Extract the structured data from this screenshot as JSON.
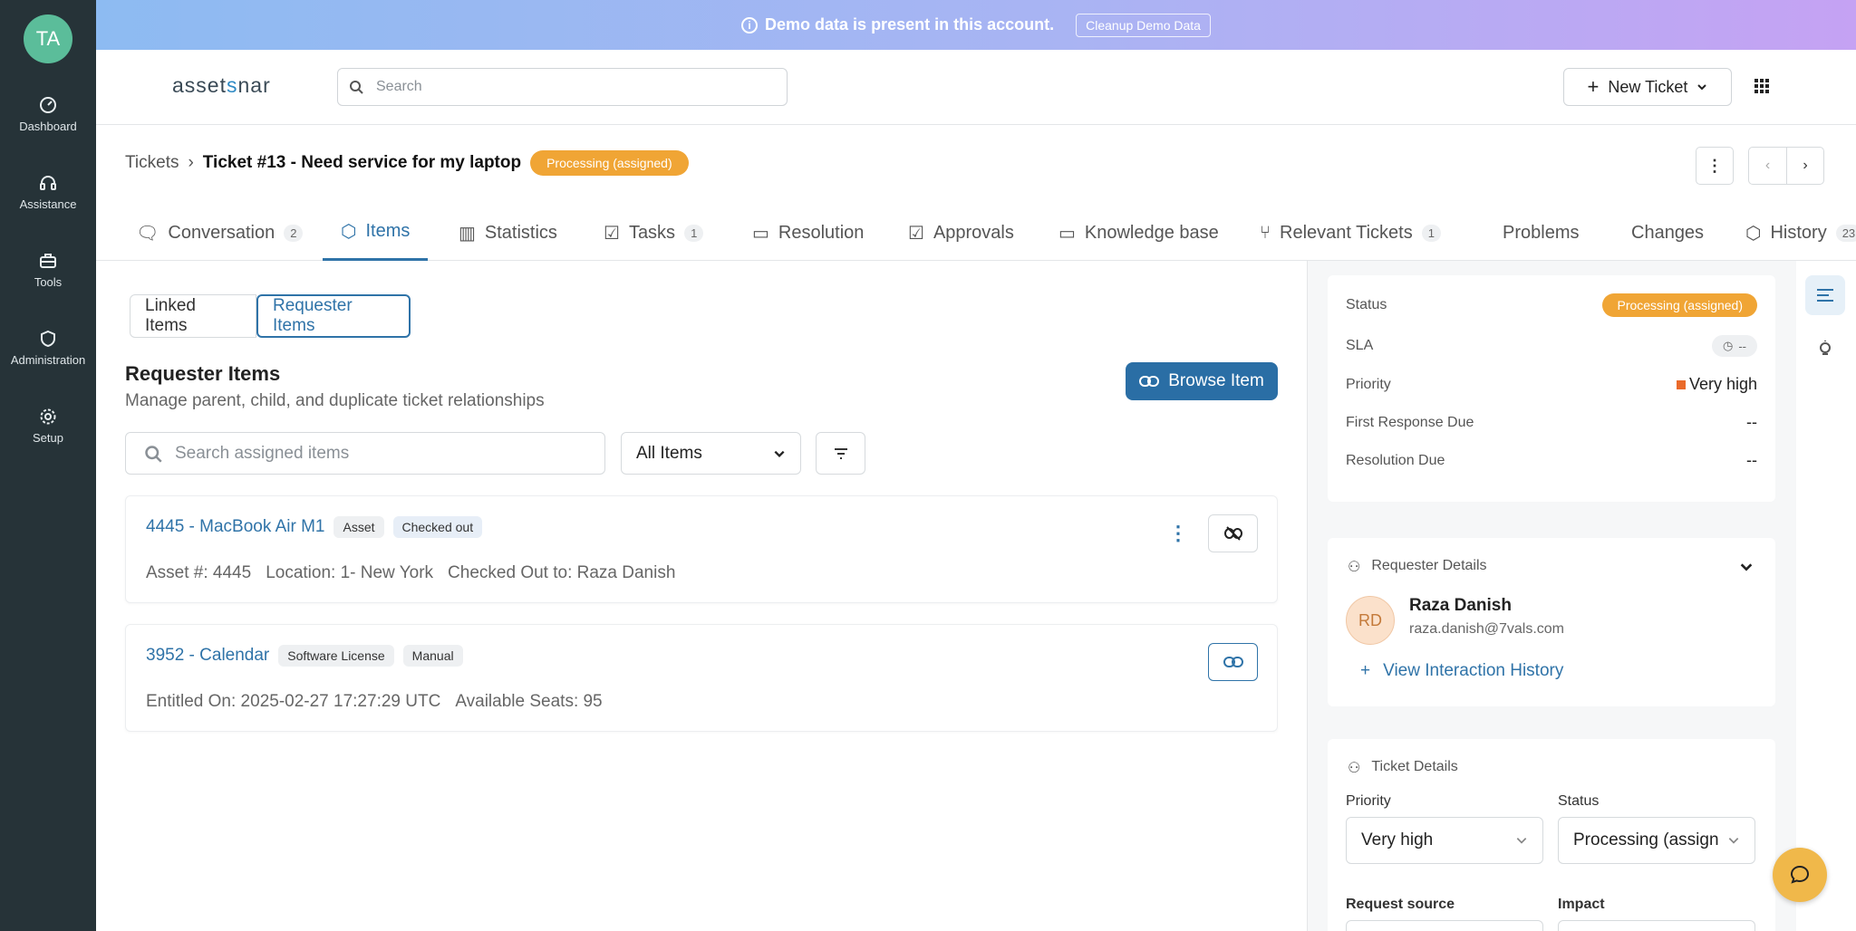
{
  "user": {
    "initials": "TA"
  },
  "sidebar": {
    "items": [
      {
        "label": "Dashboard",
        "icon": "dashboard-icon"
      },
      {
        "label": "Assistance",
        "icon": "headset-icon"
      },
      {
        "label": "Tools",
        "icon": "toolbox-icon"
      },
      {
        "label": "Administration",
        "icon": "shield-icon"
      },
      {
        "label": "Setup",
        "icon": "gear-icon"
      }
    ]
  },
  "banner": {
    "text": "Demo data is present in this account.",
    "button": "Cleanup Demo Data"
  },
  "header": {
    "logo_a": "asset",
    "logo_b": "s",
    "logo_c": "nar",
    "search_placeholder": "Search",
    "new_ticket": "New Ticket"
  },
  "breadcrumb": {
    "root": "Tickets",
    "current": "Ticket #13 - Need service for my laptop",
    "status": "Processing (assigned)"
  },
  "tabs": [
    {
      "label": "Conversation",
      "count": "2"
    },
    {
      "label": "Items",
      "count": ""
    },
    {
      "label": "Statistics",
      "count": ""
    },
    {
      "label": "Tasks",
      "count": "1"
    },
    {
      "label": "Resolution",
      "count": ""
    },
    {
      "label": "Approvals",
      "count": ""
    },
    {
      "label": "Knowledge base",
      "count": ""
    },
    {
      "label": "Relevant Tickets",
      "count": "1"
    },
    {
      "label": "Problems",
      "count": ""
    },
    {
      "label": "Changes",
      "count": ""
    },
    {
      "label": "History",
      "count": "23"
    }
  ],
  "items": {
    "seg_linked": "Linked Items",
    "seg_requester": "Requester Items",
    "title": "Requester Items",
    "subtitle": "Manage parent, child, and duplicate ticket relationships",
    "browse": "Browse Item",
    "search_placeholder": "Search assigned items",
    "filter_value": "All Items",
    "cards": [
      {
        "link": "4445 - MacBook Air M1",
        "tags": [
          "Asset",
          "Checked out"
        ],
        "meta": [
          "Asset #: 4445",
          "Location: 1- New York",
          "Checked Out to: Raza Danish"
        ]
      },
      {
        "link": "3952 - Calendar",
        "tags": [
          "Software License",
          "Manual"
        ],
        "meta": [
          "Entitled On: 2025-02-27 17:27:29 UTC",
          "Available Seats: 95"
        ]
      }
    ]
  },
  "summary": {
    "status_label": "Status",
    "status_value": "Processing (assigned)",
    "sla_label": "SLA",
    "sla_value": "--",
    "priority_label": "Priority",
    "priority_value": "Very high",
    "frd_label": "First Response Due",
    "frd_value": "--",
    "rd_label": "Resolution Due",
    "rd_value": "--",
    "priority_color": "#ea6a2a"
  },
  "requester": {
    "heading": "Requester Details",
    "initials": "RD",
    "name": "Raza Danish",
    "email": "raza.danish@7vals.com",
    "history": "View Interaction History"
  },
  "ticket_details": {
    "heading": "Ticket Details",
    "priority_label": "Priority",
    "priority_value": "Very high",
    "status_label": "Status",
    "status_value": "Processing (assign",
    "source_label": "Request source",
    "impact_label": "Impact"
  },
  "colors": {
    "accent": "#2f73a8",
    "sidebar": "#263338",
    "badge": "#f0a535"
  }
}
